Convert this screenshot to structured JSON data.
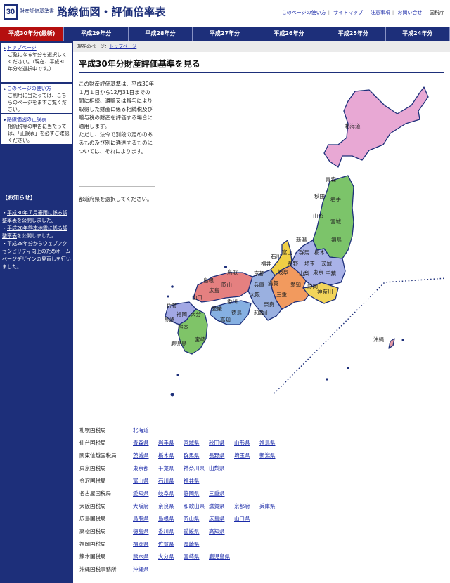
{
  "header": {
    "logo_number": "30",
    "logo_small": "財産評価基準書",
    "title": "路線価図・評価倍率表",
    "links": [
      "このページの使い方",
      "サイトマップ",
      "注意事項",
      "お問い合せ"
    ],
    "agency": "国税庁"
  },
  "tabs": [
    "平成30年分(最新)",
    "平成29年分",
    "平成28年分",
    "平成27年分",
    "平成26年分",
    "平成25年分",
    "平成24年分"
  ],
  "sidebar": {
    "box1_link": "トップページ",
    "box1_text": "ご覧になる年分を選択してください。（現在、平成30年分を選択中です。）",
    "box2_link": "このページの使い方",
    "box2_text": "ご利用に当たっては、こちらのページをまずご覧ください。",
    "box3_link": "路線価図の正誤表",
    "box3_text": "相続税等の申告に当たっては、「正誤表」を必ずご確認ください。",
    "notice_heading": "【お知らせ】",
    "notices": [
      {
        "prefix": "・",
        "link": "平成30年７月豪雨に係る調整率表",
        "suffix": "を公開しました。"
      },
      {
        "prefix": "・",
        "link": "平成28年熊本地震に係る調整率表",
        "suffix": "を公開しました。"
      },
      {
        "prefix": "・",
        "link": "",
        "suffix": "平成28年分からウェブアクセシビリティ向上のためホームページデザインの見直しを行いました。"
      }
    ]
  },
  "main": {
    "breadcrumb_prefix": "現在のページ：",
    "breadcrumb_link": "トップページ",
    "title": "平成30年分財産評価基準を見る",
    "intro1": "この財産評価基準は、平成30年１月１日から12月31日までの間に相続、遺贈又は贈与により取得した財産に係る相続税及び贈与税の財産を評価する場合に適用します。",
    "intro2": "ただし、法令で別段の定めのあるもの及び別に通達するものについては、それによります。",
    "select_prompt": "都道府県を選択してください。"
  },
  "map_labels": [
    "北海道",
    "青森",
    "秋田",
    "岩手",
    "山形",
    "宮城",
    "新潟",
    "福島",
    "石川",
    "富山",
    "群馬",
    "栃木",
    "福井",
    "長野",
    "埼玉",
    "茨城",
    "鳥取",
    "京都",
    "岐阜",
    "山梨",
    "東京",
    "千葉",
    "島根",
    "兵庫",
    "滋賀",
    "愛知",
    "静岡",
    "神奈川",
    "岡山",
    "広島",
    "大阪",
    "三重",
    "山口",
    "奈良",
    "香川",
    "佐賀",
    "福岡",
    "徳島",
    "和歌山",
    "愛媛",
    "長崎",
    "大分",
    "高知",
    "熊本",
    "宮崎",
    "鹿児島",
    "沖縄"
  ],
  "bureaus": [
    {
      "name": "札幌国税局",
      "prefs": [
        "北海道"
      ]
    },
    {
      "name": "仙台国税局",
      "prefs": [
        "青森県",
        "岩手県",
        "宮城県",
        "秋田県",
        "山形県",
        "福島県"
      ]
    },
    {
      "name": "関東信越国税局",
      "prefs": [
        "茨城県",
        "栃木県",
        "群馬県",
        "長野県",
        "埼玉県",
        "新潟県"
      ]
    },
    {
      "name": "東京国税局",
      "prefs": [
        "東京都",
        "千葉県",
        "神奈川県",
        "山梨県"
      ]
    },
    {
      "name": "金沢国税局",
      "prefs": [
        "富山県",
        "石川県",
        "福井県"
      ]
    },
    {
      "name": "名古屋国税局",
      "prefs": [
        "愛知県",
        "岐阜県",
        "静岡県",
        "三重県"
      ]
    },
    {
      "name": "大阪国税局",
      "prefs": [
        "大阪府",
        "奈良県",
        "和歌山県",
        "滋賀県",
        "京都府",
        "兵庫県"
      ]
    },
    {
      "name": "広島国税局",
      "prefs": [
        "鳥取県",
        "島根県",
        "岡山県",
        "広島県",
        "山口県"
      ]
    },
    {
      "name": "高松国税局",
      "prefs": [
        "徳島県",
        "香川県",
        "愛媛県",
        "高知県"
      ]
    },
    {
      "name": "福岡国税局",
      "prefs": [
        "福岡県",
        "佐賀県",
        "長崎県"
      ]
    },
    {
      "name": "熊本国税局",
      "prefs": [
        "熊本県",
        "大分県",
        "宮崎県",
        "鹿児島県"
      ]
    },
    {
      "name": "沖縄国税事務所",
      "prefs": [
        "沖縄県"
      ]
    }
  ],
  "colors": {
    "navy": "#1d2f7a",
    "active_tab": "#b50f0f",
    "hokkaido": "#e8a8d4",
    "tohoku": "#7cc46a",
    "kanto_shinetsu": "#a9b2e8",
    "tokyo": "#f2d45a",
    "kanazawa": "#f0cf45",
    "nagoya": "#f29a5e",
    "osaka": "#9ab0e0",
    "hiroshima": "#e58080",
    "takamatsu": "#86b0e2",
    "fukuoka": "#a2a8e4",
    "kumamoto": "#7fc468",
    "okinawa": "#e59aa4"
  }
}
